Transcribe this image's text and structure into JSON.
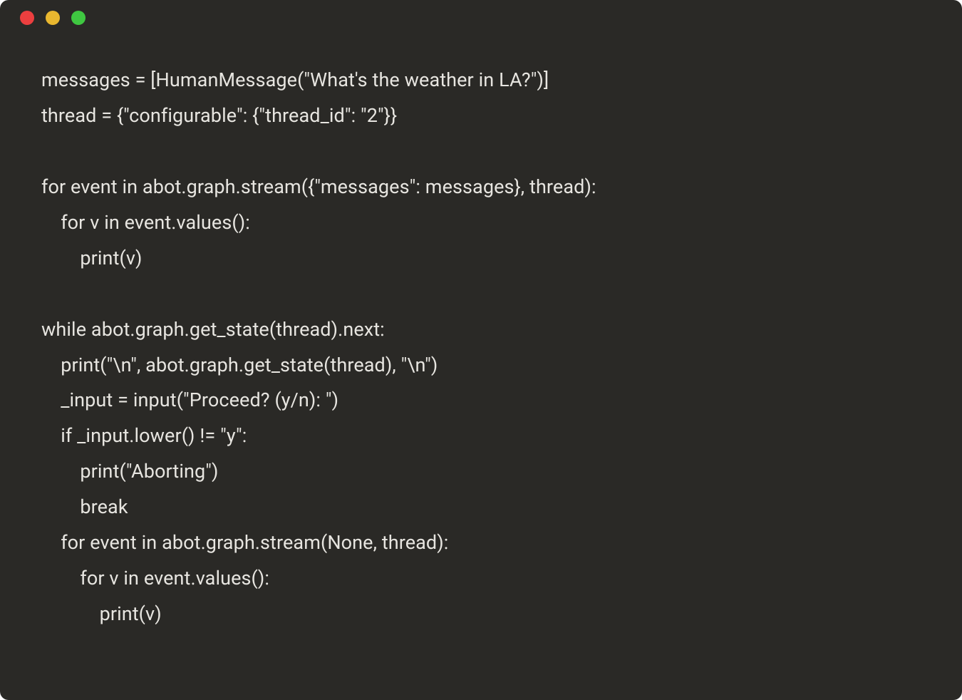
{
  "titlebar": {
    "buttons": [
      {
        "name": "close",
        "color": "#ec3f3f"
      },
      {
        "name": "minimize",
        "color": "#e9b72f"
      },
      {
        "name": "zoom",
        "color": "#3fc741"
      }
    ]
  },
  "code": {
    "lines": [
      "messages = [HumanMessage(\"What's the weather in LA?\")]",
      "thread = {\"configurable\": {\"thread_id\": \"2\"}}",
      "",
      "for event in abot.graph.stream({\"messages\": messages}, thread):",
      "    for v in event.values():",
      "        print(v)",
      "",
      "while abot.graph.get_state(thread).next:",
      "    print(\"\\n\", abot.graph.get_state(thread), \"\\n\")",
      "    _input = input(\"Proceed? (y/n): \")",
      "    if _input.lower() != \"y\":",
      "        print(\"Aborting\")",
      "        break",
      "    for event in abot.graph.stream(None, thread):",
      "        for v in event.values():",
      "            print(v)"
    ]
  }
}
